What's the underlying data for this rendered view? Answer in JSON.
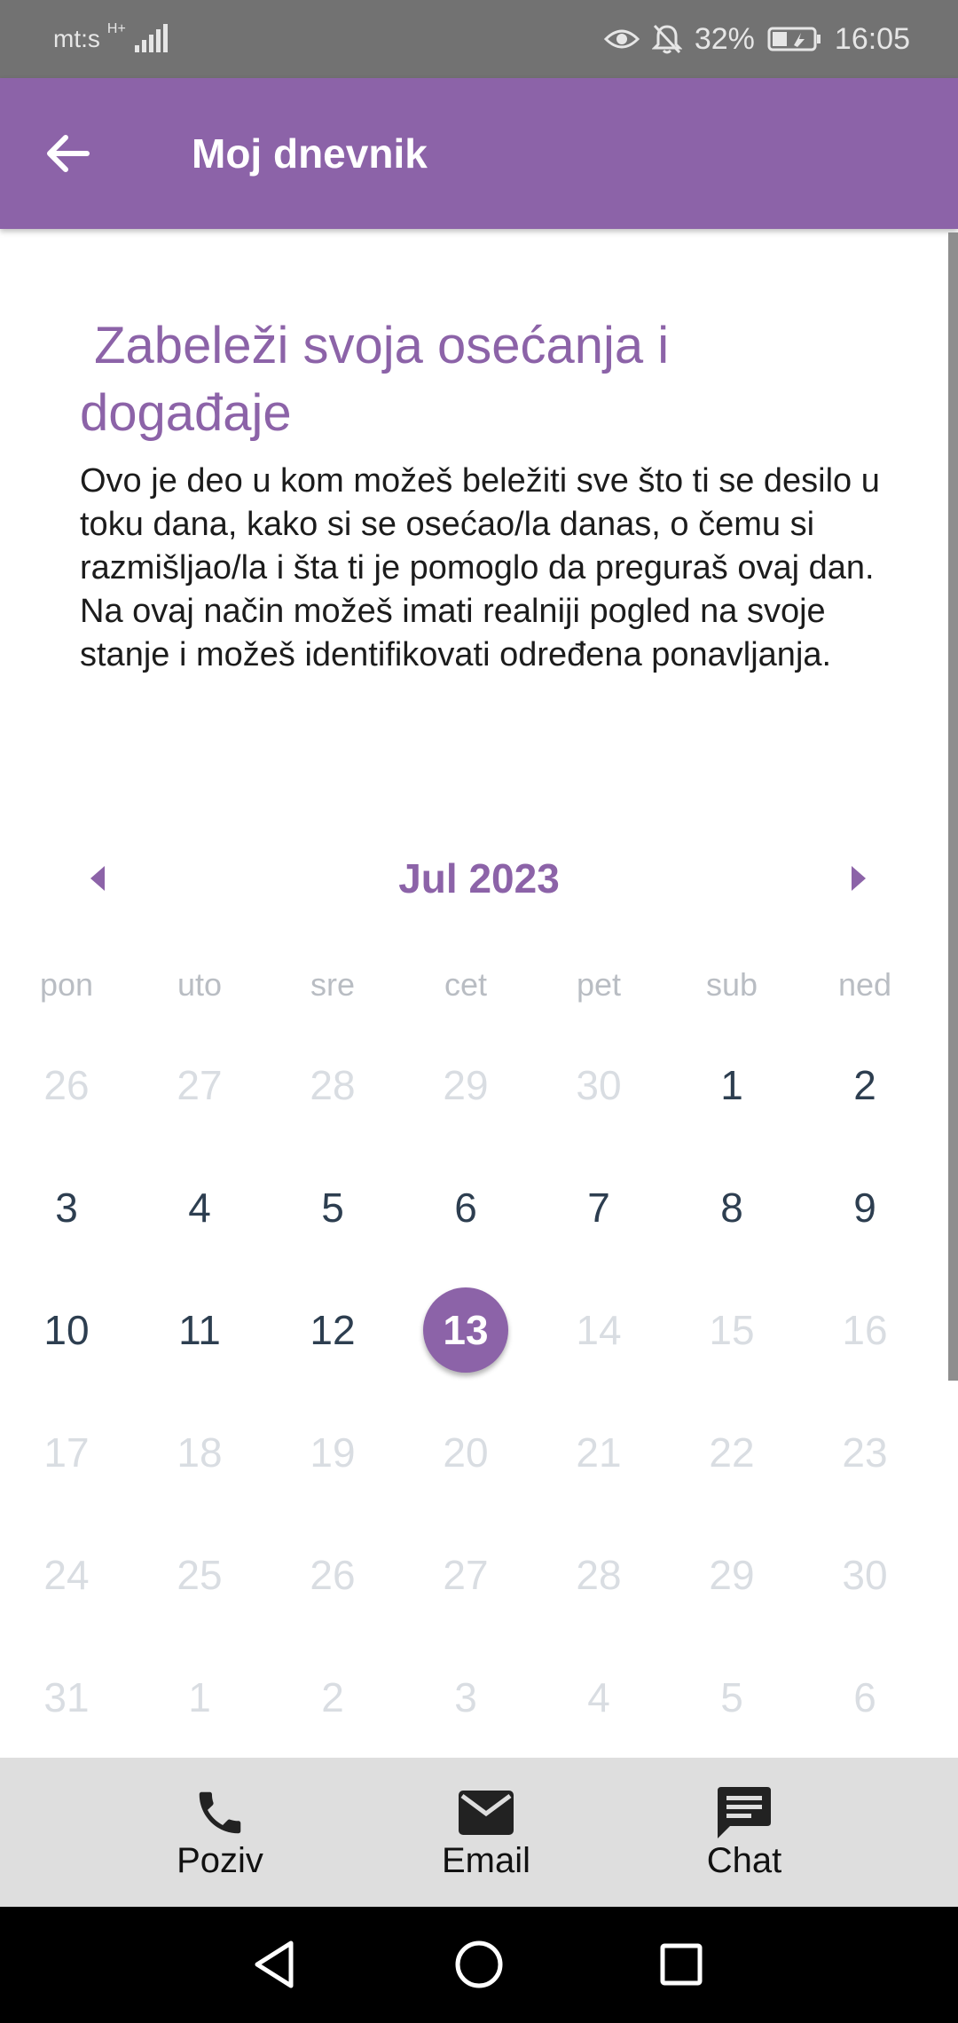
{
  "status_bar": {
    "carrier": "mt:s",
    "network": "H+",
    "battery": "32%",
    "time": "16:05"
  },
  "app_bar": {
    "title": "Moj dnevnik",
    "back_icon": "arrow-back-icon"
  },
  "intro": {
    "heading": " Zabeleži svoja osećanja i događaje",
    "text": "Ovo je deo u kom možeš beležiti sve što ti se desilo u toku dana, kako si se osećao/la danas, o čemu si razmišljao/la i šta ti je pomoglo da preguraš ovaj dan. Na ovaj način možeš imati realniji pogled na svoje stanje i možeš identifikovati određena ponavljanja."
  },
  "calendar": {
    "month_label": "Jul 2023",
    "weekdays": [
      "pon",
      "uto",
      "sre",
      "cet",
      "pet",
      "sub",
      "ned"
    ],
    "weeks": [
      [
        "26",
        "27",
        "28",
        "29",
        "30",
        "1",
        "2"
      ],
      [
        "3",
        "4",
        "5",
        "6",
        "7",
        "8",
        "9"
      ],
      [
        "10",
        "11",
        "12",
        "13",
        "14",
        "15",
        "16"
      ],
      [
        "17",
        "18",
        "19",
        "20",
        "21",
        "22",
        "23"
      ],
      [
        "24",
        "25",
        "26",
        "27",
        "28",
        "29",
        "30"
      ],
      [
        "31",
        "1",
        "2",
        "3",
        "4",
        "5",
        "6"
      ]
    ],
    "selected_day": "13",
    "accent_color": "#8c63a8"
  },
  "bottom_bar": {
    "call_label": "Poziv",
    "email_label": "Email",
    "chat_label": "Chat"
  }
}
